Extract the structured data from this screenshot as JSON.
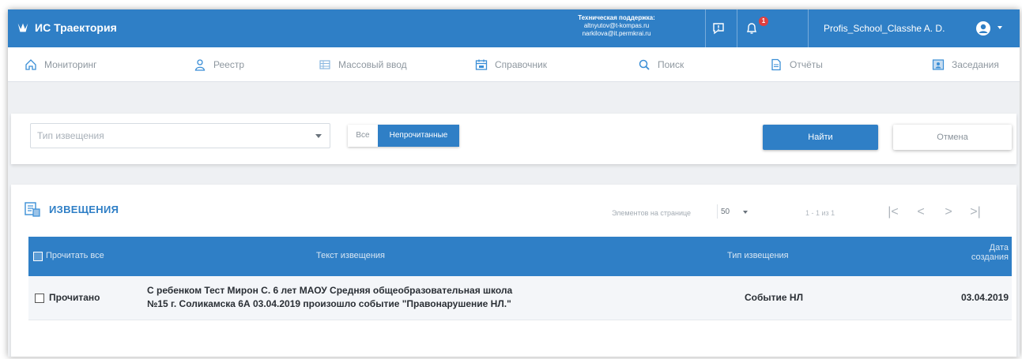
{
  "header": {
    "app_title": "ИС Траектория",
    "support_lines": [
      "Техническая поддержка:",
      "altnyutov@t-kompas.ru",
      "narkilova@it.permkrai.ru"
    ],
    "notification_count": "1",
    "user_name": "Profis_School_Classhe A. D."
  },
  "nav": {
    "items": [
      {
        "label": "Мониторинг",
        "icon": "home-icon"
      },
      {
        "label": "Реестр",
        "icon": "person-icon"
      },
      {
        "label": "Массовый ввод",
        "icon": "grid-icon"
      },
      {
        "label": "Справочник",
        "icon": "calendar-book-icon"
      },
      {
        "label": "Поиск",
        "icon": "search-icon"
      },
      {
        "label": "Отчёты",
        "icon": "document-icon"
      },
      {
        "label": "Заседания",
        "icon": "meeting-icon"
      }
    ]
  },
  "filter": {
    "type_placeholder": "Тип извещения",
    "seg_all": "Все",
    "seg_unread": "Непрочитанные",
    "find_button": "Найти",
    "cancel_button": "Отмена"
  },
  "notices": {
    "title": "ИЗВЕЩЕНИЯ",
    "per_page_label": "Элементов на странице",
    "per_page_value": "50",
    "range_text": "1 - 1 из 1",
    "pager": {
      "first": "|<",
      "prev": "<",
      "next": ">",
      "last": ">|"
    },
    "columns": {
      "read_all": "Прочитать все",
      "text": "Текст извещения",
      "type": "Тип извещения",
      "date_line1": "Дата",
      "date_line2": "создания"
    },
    "rows": [
      {
        "status": "Прочитано",
        "text_line1": "С ребенком Тест Мирон С. 6 лет МАОУ Средняя общеобразовательная школа",
        "text_line2": "№15 г. Соликамска 6А 03.04.2019 произошло событие \"Правонарушение НЛ.\"",
        "type": "Событие НЛ",
        "date": "03.04.2019"
      }
    ]
  },
  "colors": {
    "brand_blue": "#2f7fc6",
    "badge_red": "#e04040"
  }
}
